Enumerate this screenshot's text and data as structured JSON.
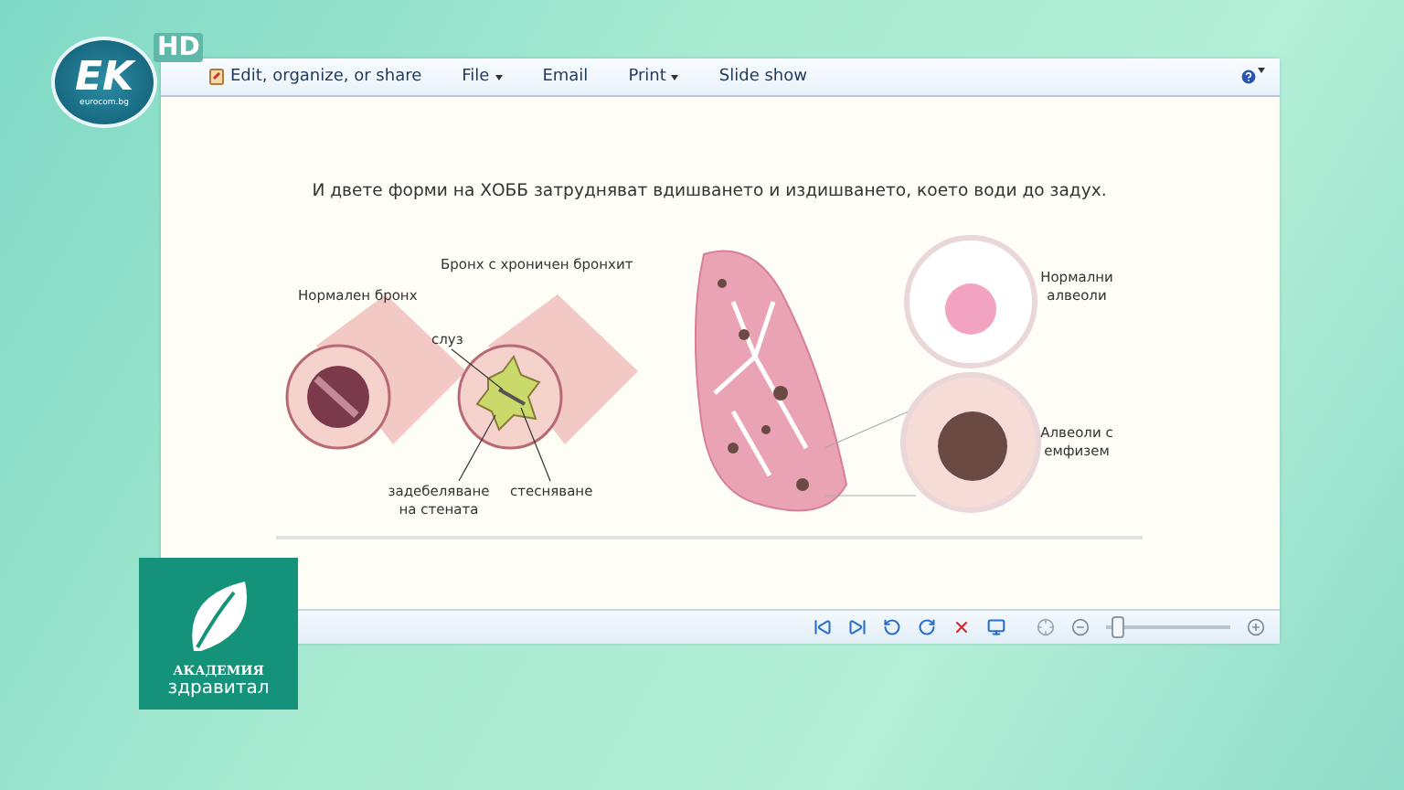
{
  "broadcast": {
    "channel_logo": {
      "text": "EK",
      "subtext": "eurocom.bg",
      "hd": "HD"
    },
    "academy_logo": {
      "line1": "АКАДЕМИЯ",
      "line2": "здравитал"
    }
  },
  "viewer": {
    "toolbar": {
      "menu": [
        {
          "label": "Edit, organize, or share",
          "kind": "icon"
        },
        {
          "label": "File",
          "kind": "dropdown"
        },
        {
          "label": "Email",
          "kind": "plain"
        },
        {
          "label": "Print",
          "kind": "dropdown"
        },
        {
          "label": "Slide show",
          "kind": "plain"
        }
      ]
    },
    "image": {
      "title": "И двете форми на ХОББ затрудняват вдишването и издишването, което води до задух.",
      "chronic_bronchitis": "Бронх с хроничен бронхит",
      "normal_bronchus": "Нормален бронх",
      "mucus": "слуз",
      "wall_thickening": "задебеляване на стената",
      "narrowing": "стесняване",
      "normal_alveoli": "Нормални алвеоли",
      "emphysema_alveoli": "Алвеоли с емфизем"
    },
    "zoom": {
      "level": 0.05
    }
  }
}
